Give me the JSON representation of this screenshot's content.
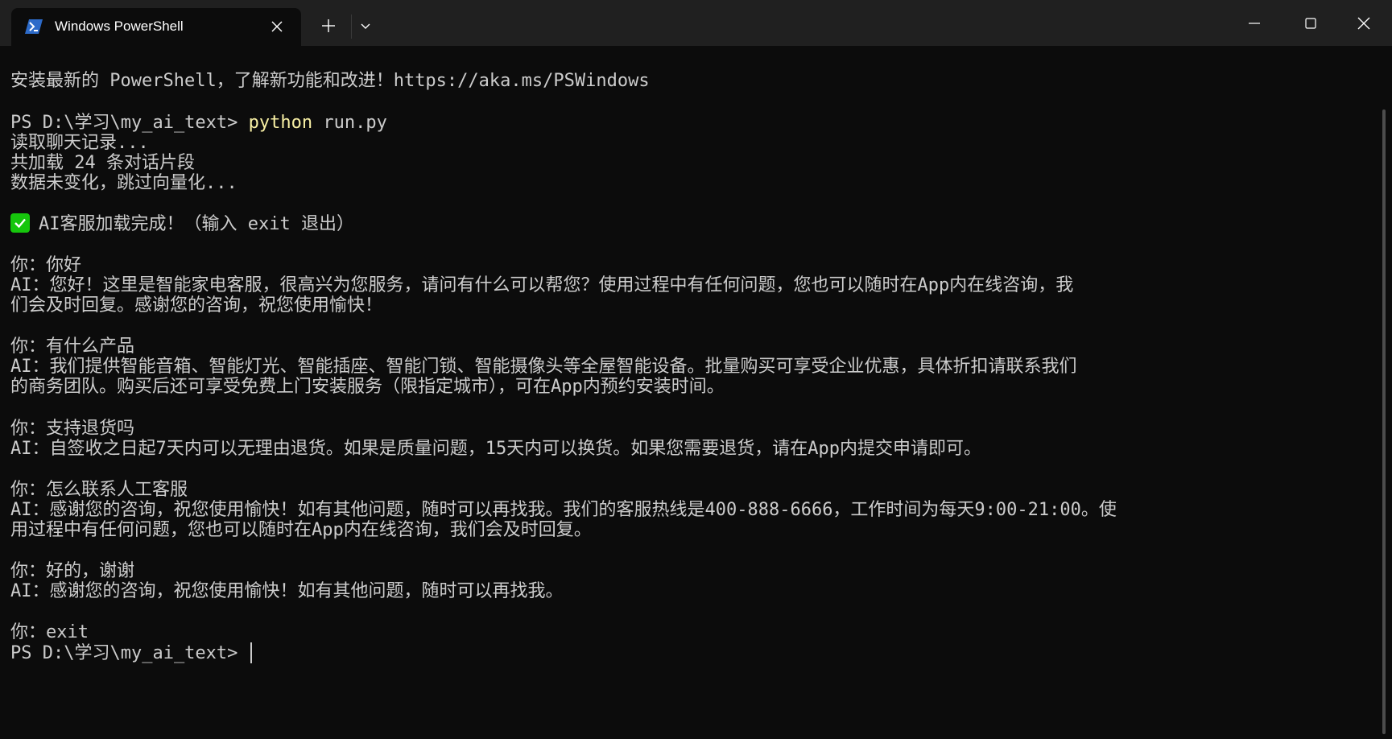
{
  "window": {
    "tab_title": "Windows PowerShell",
    "icons": {
      "tab": "powershell-icon",
      "close_tab": "close-icon",
      "new_tab": "plus-icon",
      "dropdown": "chevron-down-icon",
      "minimize": "minimize-icon",
      "maximize": "maximize-icon",
      "close_window": "close-icon"
    }
  },
  "colors": {
    "background": "#0c0c0c",
    "titlebar": "#202020",
    "text": "#cccccc",
    "command": "#f9f1a5",
    "check": "#16c60c",
    "powershell_blue": "#2d6bc9"
  },
  "terminal": {
    "banner": "安装最新的 PowerShell，了解新功能和改进！https://aka.ms/PSWindows",
    "prompt": "PS D:\\学习\\my_ai_text> ",
    "command_keyword": "python",
    "command_args": " run.py",
    "status": [
      "读取聊天记录...",
      "共加载 24 条对话片段",
      "数据未变化，跳过向量化..."
    ],
    "ready_message": "AI客服加载完成！（输入 exit 退出）",
    "conversation": [
      {
        "user": "你：你好",
        "ai_lines": [
          "AI：您好！这里是智能家电客服，很高兴为您服务，请问有什么可以帮您？使用过程中有任何问题，您也可以随时在App内在线咨询，我",
          "们会及时回复。感谢您的咨询，祝您使用愉快！"
        ]
      },
      {
        "user": "你：有什么产品",
        "ai_lines": [
          "AI：我们提供智能音箱、智能灯光、智能插座、智能门锁、智能摄像头等全屋智能设备。批量购买可享受企业优惠，具体折扣请联系我们",
          "的商务团队。购买后还可享受免费上门安装服务（限指定城市），可在App内预约安装时间。"
        ]
      },
      {
        "user": "你：支持退货吗",
        "ai_lines": [
          "AI：自签收之日起7天内可以无理由退货。如果是质量问题，15天内可以换货。如果您需要退货，请在App内提交申请即可。"
        ]
      },
      {
        "user": "你：怎么联系人工客服",
        "ai_lines": [
          "AI：感谢您的咨询，祝您使用愉快！如有其他问题，随时可以再找我。我们的客服热线是400-888-6666，工作时间为每天9:00-21:00。使",
          "用过程中有任何问题，您也可以随时在App内在线咨询，我们会及时回复。"
        ]
      },
      {
        "user": "你：好的，谢谢",
        "ai_lines": [
          "AI：感谢您的咨询，祝您使用愉快！如有其他问题，随时可以再找我。"
        ]
      },
      {
        "user": "你：exit",
        "ai_lines": []
      }
    ],
    "final_prompt": "PS D:\\学习\\my_ai_text> "
  }
}
